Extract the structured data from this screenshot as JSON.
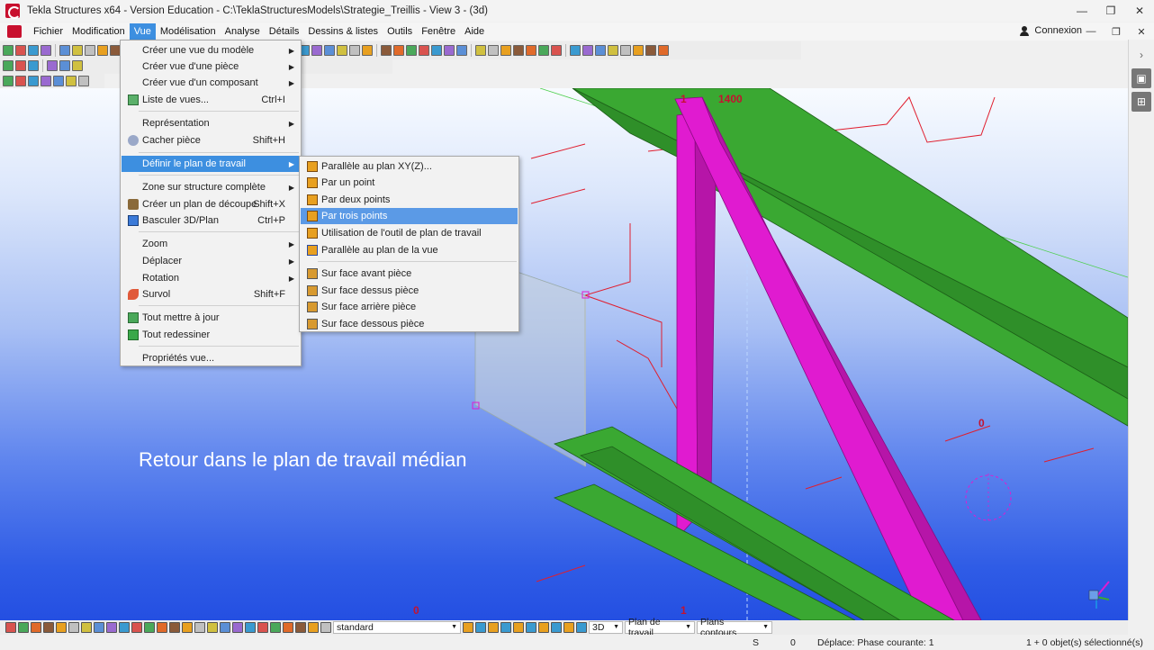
{
  "window": {
    "title": "Tekla Structures x64 - Version Education - C:\\TeklaStructuresModels\\Strategie_Treillis - View 3 - (3d)",
    "controls": [
      "—",
      "❐",
      "✕"
    ]
  },
  "menubar": {
    "items": [
      "Fichier",
      "Modification",
      "Vue",
      "Modélisation",
      "Analyse",
      "Détails",
      "Dessins & listes",
      "Outils",
      "Fenêtre",
      "Aide"
    ],
    "active_index": 2,
    "connexion": "Connexion",
    "mdi_controls": [
      "—",
      "❐",
      "✕"
    ]
  },
  "vue_menu": {
    "items": [
      {
        "label": "Créer une vue du modèle",
        "submenu": true
      },
      {
        "label": "Créer vue d'une pièce",
        "submenu": true
      },
      {
        "label": "Créer vue d'un composant",
        "submenu": true
      },
      {
        "label": "Liste de vues...",
        "shortcut": "Ctrl+I",
        "icon": "list-views-icon"
      },
      {
        "label": "Représentation",
        "submenu": true
      },
      {
        "label": "Cacher pièce",
        "shortcut": "Shift+H",
        "icon": "hide-part-icon"
      },
      {
        "label": "Définir le plan de travail",
        "submenu": true,
        "highlighted": true
      },
      {
        "label": "Zone sur structure complète",
        "submenu": true
      },
      {
        "label": "Créer un plan de découpe",
        "shortcut": "Shift+X",
        "icon": "cut-plane-icon"
      },
      {
        "label": "Basculer 3D/Plan",
        "shortcut": "Ctrl+P",
        "icon": "toggle-3d-icon"
      },
      {
        "label": "Zoom",
        "submenu": true
      },
      {
        "label": "Déplacer",
        "submenu": true
      },
      {
        "label": "Rotation",
        "submenu": true
      },
      {
        "label": "Survol",
        "shortcut": "Shift+F",
        "icon": "fly-icon"
      },
      {
        "label": "Tout mettre à jour",
        "icon": "update-all-icon"
      },
      {
        "label": "Tout redessiner",
        "icon": "redraw-all-icon"
      },
      {
        "label": "Propriétés vue..."
      }
    ]
  },
  "work_plane_menu": {
    "items": [
      {
        "label": "Parallèle au plan XY(Z)...",
        "icon": "plane-xy-icon"
      },
      {
        "label": "Par un point",
        "icon": "one-point-icon"
      },
      {
        "label": "Par deux points",
        "icon": "two-points-icon"
      },
      {
        "label": "Par trois points",
        "icon": "three-points-icon",
        "highlighted": true
      },
      {
        "label": "Utilisation de l'outil de plan de travail",
        "icon": "work-plane-tool-icon"
      },
      {
        "label": "Parallèle au plan de la vue",
        "icon": "view-plane-icon"
      },
      {
        "label": "Sur face avant pièce",
        "icon": "front-face-icon"
      },
      {
        "label": "Sur face dessus pièce",
        "icon": "top-face-icon"
      },
      {
        "label": "Sur face arrière pièce",
        "icon": "back-face-icon"
      },
      {
        "label": "Sur face dessous pièce",
        "icon": "bottom-face-icon"
      }
    ]
  },
  "viewport": {
    "caption": "Retour dans le plan de travail médian",
    "labels": [
      "1",
      "1400",
      "0",
      "0",
      "1"
    ]
  },
  "bottombar": {
    "filter": "standard",
    "view_type": "3D",
    "work_plane": "Plan de travail",
    "contour_plans": "Plans contours"
  },
  "statusbar": {
    "snap": "S",
    "count": "0",
    "command": "Déplace: Phase courante: 1",
    "selection": "1 + 0 objet(s) sélectionné(s)"
  },
  "colors": {
    "menu_highlight": "#3d8fe0",
    "beam_green": "#3aa832",
    "brace_magenta": "#e01bd0",
    "label_red": "#c41230"
  }
}
